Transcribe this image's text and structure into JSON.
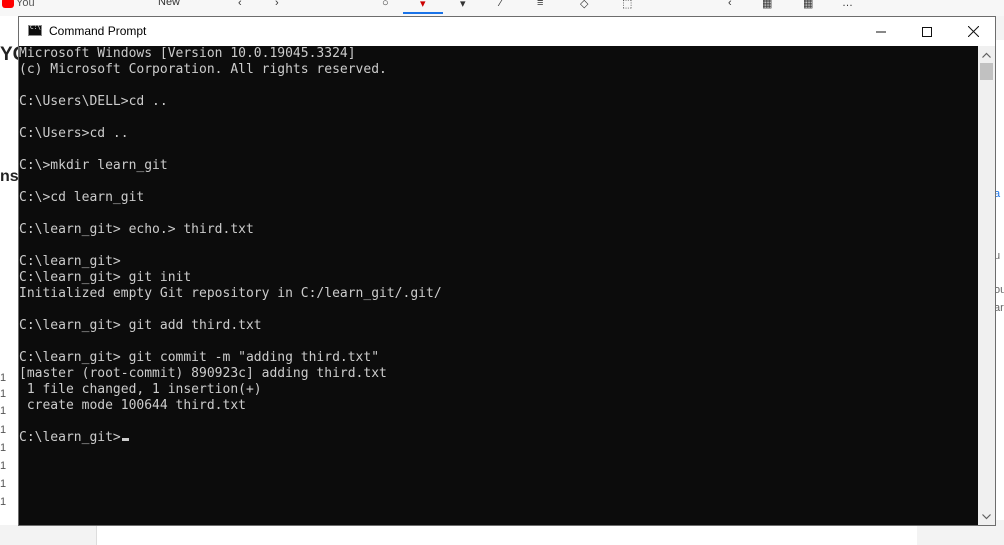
{
  "background_app": {
    "you_label": "You",
    "new_label": "New",
    "left_fragments": [
      "YC",
      "nst",
      "1",
      "1",
      "1",
      "1",
      "1",
      "1",
      "1",
      "1"
    ],
    "right_fragments": [
      "a",
      "u",
      "ou",
      "ar"
    ]
  },
  "window": {
    "title": "Command Prompt",
    "minimize_label": "Minimize",
    "maximize_label": "Maximize",
    "close_label": "Close"
  },
  "console": {
    "lines": [
      "Microsoft Windows [Version 10.0.19045.3324]",
      "(c) Microsoft Corporation. All rights reserved.",
      "",
      "C:\\Users\\DELL>cd ..",
      "",
      "C:\\Users>cd ..",
      "",
      "C:\\>mkdir learn_git",
      "",
      "C:\\>cd learn_git",
      "",
      "C:\\learn_git> echo.> third.txt",
      "",
      "C:\\learn_git>",
      "C:\\learn_git> git init",
      "Initialized empty Git repository in C:/learn_git/.git/",
      "",
      "C:\\learn_git> git add third.txt",
      "",
      "C:\\learn_git> git commit -m \"adding third.txt\"",
      "[master (root-commit) 890923c] adding third.txt",
      " 1 file changed, 1 insertion(+)",
      " create mode 100644 third.txt",
      "",
      "C:\\learn_git>"
    ]
  },
  "colors": {
    "console_bg": "#0c0c0c",
    "console_text": "#cccccc",
    "titlebar_bg": "#ffffff"
  }
}
